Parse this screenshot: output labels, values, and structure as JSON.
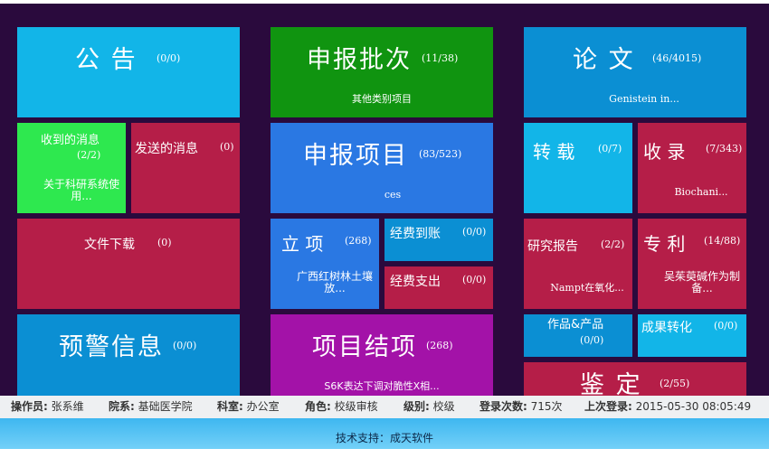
{
  "tiles": {
    "notice": {
      "title": "公 告",
      "count": "(0/0)"
    },
    "batch": {
      "title": "申报批次",
      "count": "(11/38)",
      "sub": "其他类别项目"
    },
    "paper": {
      "title": "论 文",
      "count": "(46/4015)",
      "sub": "Genistein in..."
    },
    "received": {
      "title": "收到的消息",
      "count": "(2/2)",
      "sub": "关于科研系统使用..."
    },
    "sent": {
      "title": "发送的消息",
      "count": "(0)"
    },
    "project": {
      "title": "申报项目",
      "count": "(83/523)",
      "sub": "ces"
    },
    "reprint": {
      "title": "转 载",
      "count": "(0/7)"
    },
    "indexed": {
      "title": "收 录",
      "count": "(7/343)",
      "sub": "Biochani..."
    },
    "download": {
      "title": "文件下载",
      "count": "(0)"
    },
    "approved": {
      "title": "立 项",
      "count": "(268)",
      "sub": "广西红树林土壤放..."
    },
    "funds_in": {
      "title": "经费到账",
      "count": "(0/0)"
    },
    "funds_out": {
      "title": "经费支出",
      "count": "(0/0)"
    },
    "report": {
      "title": "研究报告",
      "count": "(2/2)",
      "sub": "Nampt在氧化..."
    },
    "patent": {
      "title": "专 利",
      "count": "(14/88)",
      "sub": "吴茱萸碱作为制备..."
    },
    "warning": {
      "title": "预警信息",
      "count": "(0/0)"
    },
    "closing": {
      "title": "项目结项",
      "count": "(268)",
      "sub": "S6K表达下调对脆性X相..."
    },
    "works": {
      "title": "作品&产品",
      "count": "(0/0)"
    },
    "transfer": {
      "title": "成果转化",
      "count": "(0/0)"
    },
    "appraisal": {
      "title": "鉴 定",
      "count": "(2/55)"
    }
  },
  "status": {
    "operator_k": "操作员:",
    "operator_v": "张系维",
    "dept_k": "院系:",
    "dept_v": "基础医学院",
    "office_k": "科室:",
    "office_v": "办公室",
    "role_k": "角色:",
    "role_v": "校级审核",
    "level_k": "级别:",
    "level_v": "校级",
    "logins_k": "登录次数:",
    "logins_v": "715次",
    "last_k": "上次登录:",
    "last_v": "2015-05-30 08:05:49"
  },
  "footer": {
    "text": "技术支持：成天软件"
  },
  "colors": {
    "background": "#2a0a3d",
    "cyan": "#12b5e8",
    "green": "#109410",
    "blue": "#0b8fd3",
    "light_green": "#2ee84f",
    "crimson": "#b51e48",
    "royal": "#2a78e3",
    "purple": "#a312a8"
  }
}
